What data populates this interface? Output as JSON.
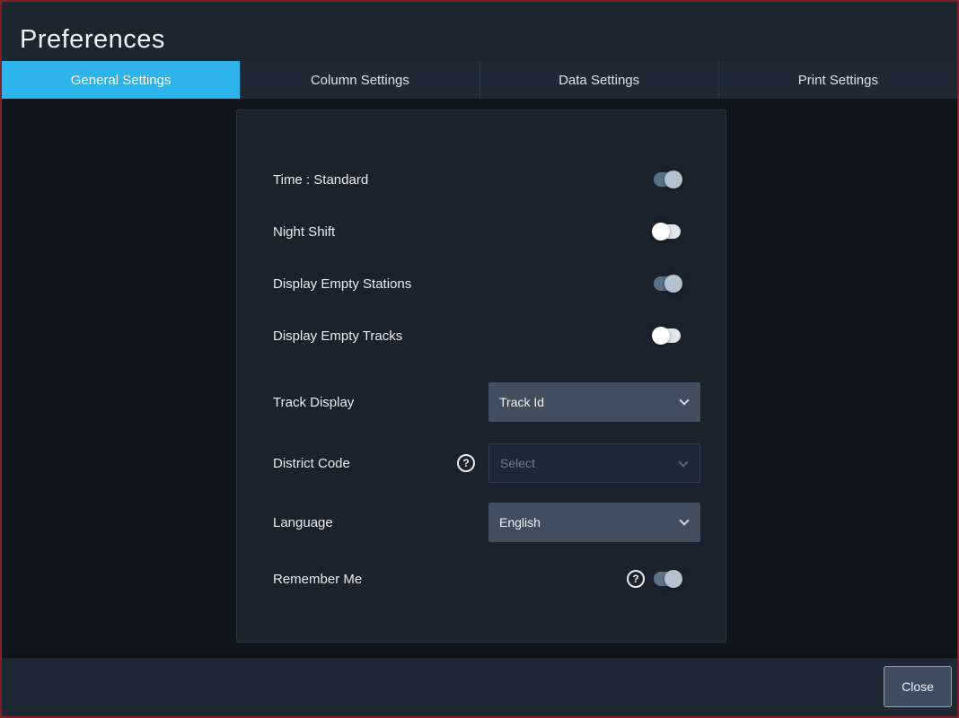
{
  "window": {
    "title": "Preferences"
  },
  "tabs": [
    {
      "label": "General Settings",
      "active": true
    },
    {
      "label": "Column Settings",
      "active": false
    },
    {
      "label": "Data Settings",
      "active": false
    },
    {
      "label": "Print Settings",
      "active": false
    }
  ],
  "settings": {
    "toggles": [
      {
        "label": "Time : Standard",
        "on": true
      },
      {
        "label": "Night Shift",
        "on": false
      },
      {
        "label": "Display Empty Stations",
        "on": true
      },
      {
        "label": "Display Empty Tracks",
        "on": false
      }
    ],
    "dropdowns": [
      {
        "label": "Track Display",
        "value": "Track Id"
      },
      {
        "label": "District Code",
        "value": "Select",
        "placeholder": true
      },
      {
        "label": "Language",
        "value": "English"
      }
    ],
    "remember": {
      "label": "Remember Me",
      "on": true
    },
    "help_icon": "?"
  },
  "footer": {
    "close": "Close"
  },
  "colors": {
    "accent": "#2eb3ea",
    "titlebar": "#1c2631",
    "panel": "#19222d",
    "toggle_on": "#5b7186",
    "toggle_off": "#e3e7ea",
    "border": "#7d2027"
  }
}
